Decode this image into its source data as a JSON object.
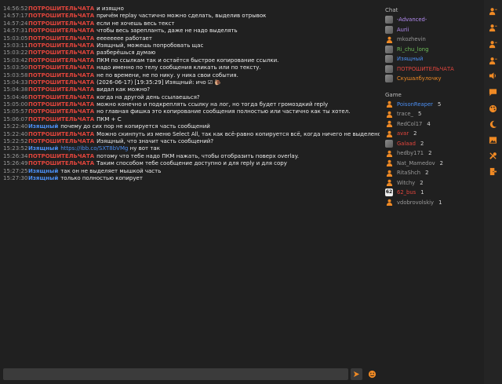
{
  "colors": {
    "accent": "#f08a24",
    "nick_red": "#e2453c",
    "nick_blue": "#4b8ef2",
    "background": "#202020"
  },
  "messages": [
    {
      "time": "14:56:52",
      "nick": "ПОТРОШИТЕЛЬЧАТА",
      "color": "red",
      "text": "и изящно"
    },
    {
      "time": "14:57:17",
      "nick": "ПОТРОШИТЕЛЬЧАТА",
      "color": "red",
      "text": "причём replay частично можно сделать, выделив отрывок"
    },
    {
      "time": "14:57:24",
      "nick": "ПОТРОШИТЕЛЬЧАТА",
      "color": "red",
      "text": "если не хочешь весь текст"
    },
    {
      "time": "14:57:31",
      "nick": "ПОТРОШИТЕЛЬЧАТА",
      "color": "red",
      "text": "чтобы весь зарепланть, даже не надо выделять"
    },
    {
      "time": "15:03:05",
      "nick": "ПОТРОШИТЕЛЬЧАТА",
      "color": "red",
      "text": "ееееееее работает"
    },
    {
      "time": "15:03:11",
      "nick": "ПОТРОШИТЕЛЬЧАТА",
      "color": "red",
      "text": "Изящный, можешь попробовать щас"
    },
    {
      "time": "15:03:22",
      "nick": "ПОТРОШИТЕЛЬЧАТА",
      "color": "red",
      "text": "разберёшься думаю"
    },
    {
      "time": "15:03:42",
      "nick": "ПОТРОШИТЕЛЬЧАТА",
      "color": "red",
      "text": "ПКМ по ссылкам так и остаётся быстрое копирование ссылки."
    },
    {
      "time": "15:03:50",
      "nick": "ПОТРОШИТЕЛЬЧАТА",
      "color": "red",
      "text": "надо именно по телу сообщения кликать или по тексту."
    },
    {
      "time": "15:03:58",
      "nick": "ПОТРОШИТЕЛЬЧАТА",
      "color": "red",
      "text": "не по времени, не по нику. у ника свои события."
    },
    {
      "time": "15:04:33",
      "nick": "ПОТРОШИТЕЛЬЧАТА",
      "color": "red",
      "text": "(2026-06-17) [19:35:29] Изящный: ичо ☑ 🐌"
    },
    {
      "time": "15:04:38",
      "nick": "ПОТРОШИТЕЛЬЧАТА",
      "color": "red",
      "text": "видал как можно?"
    },
    {
      "time": "15:04:46",
      "nick": "ПОТРОШИТЕЛЬЧАТА",
      "color": "red",
      "text": "когда на другой день ссылаешься?"
    },
    {
      "time": "15:05:00",
      "nick": "ПОТРОШИТЕЛЬЧАТА",
      "color": "red",
      "text": "можно конечно и подкреплять ссылку на лог, но тогда будет громоздкий reply"
    },
    {
      "time": "15:05:57",
      "nick": "ПОТРОШИТЕЛЬЧАТА",
      "color": "red",
      "text": "но главная фишка это копирование сообщения полностью или частично как ты хотел."
    },
    {
      "time": "15:06:07",
      "nick": "ПОТРОШИТЕЛЬЧАТА",
      "color": "red",
      "text": "ПКМ + С"
    },
    {
      "time": "15:22:40",
      "nick": "Изящный",
      "color": "blue",
      "text": "почему до сих пор не копируется часть сообщений"
    },
    {
      "time": "15:22:40",
      "nick": "ПОТРОШИТЕЛЬЧАТА",
      "color": "red",
      "text": "Можно скинпуть из меню Select All, так как всё-равно копируется всё, когда ничего не выделено."
    },
    {
      "time": "15:22:52",
      "nick": "ПОТРОШИТЕЛЬЧАТА",
      "color": "red",
      "text": "Изящный, что значит часть сообщений?"
    },
    {
      "time": "15:23:52",
      "nick": "Изящный",
      "color": "blue",
      "text": "https://ibb.co/SXT8bVMg",
      "link": true,
      "suffix": "ну вот так"
    },
    {
      "time": "15:26:34",
      "nick": "ПОТРОШИТЕЛЬЧАТА",
      "color": "red",
      "text": "потому что тебе надо ПКМ нажать, чтобы отобразить поверх overlay."
    },
    {
      "time": "15:26:49",
      "nick": "ПОТРОШИТЕЛЬЧАТА",
      "color": "red",
      "text": "Таким способом тебе сообщение доступно и для reply и для copy"
    },
    {
      "time": "15:27:25",
      "nick": "Изящный",
      "color": "blue",
      "text": "так он не выделяет мышкой часть"
    },
    {
      "time": "15:27:30",
      "nick": "Изящный",
      "color": "blue",
      "text": "только полностью копирует"
    }
  ],
  "sidebar": {
    "chat_title": "Chat",
    "chat_users": [
      {
        "name": "-Advanced-",
        "color": "#b48cf2",
        "avatar": "pic"
      },
      {
        "name": "Aurii",
        "color": "#b48cf2",
        "avatar": "pic"
      },
      {
        "name": "mkozhevin",
        "color": "#9a9a9a",
        "avatar": "person"
      },
      {
        "name": "Ri_chu_long",
        "color": "#6fbf5a",
        "avatar": "pic"
      },
      {
        "name": "Изящный",
        "color": "#4b8ef2",
        "avatar": "pic"
      },
      {
        "name": "ПОТРОШИТЕЛЬЧАТА",
        "color": "#e2453c",
        "avatar": "pic"
      },
      {
        "name": "Скушалбулочку",
        "color": "#f08a24",
        "avatar": "pic"
      }
    ],
    "game_title": "Game",
    "game_users": [
      {
        "name": "PoisonReaper",
        "count": "5",
        "color": "#4b8ef2",
        "avatar": "person"
      },
      {
        "name": "trace_",
        "count": "5",
        "color": "#9a9a9a",
        "avatar": "person"
      },
      {
        "name": "RedCol17",
        "count": "4",
        "color": "#9a9a9a",
        "avatar": "person"
      },
      {
        "name": "avar",
        "count": "2",
        "color": "#e2453c",
        "avatar": "person"
      },
      {
        "name": "Galaad",
        "count": "2",
        "color": "#e2453c",
        "avatar": "pic"
      },
      {
        "name": "hedby171",
        "count": "2",
        "color": "#9a9a9a",
        "avatar": "person"
      },
      {
        "name": "Nat_Mamedov",
        "count": "2",
        "color": "#9a9a9a",
        "avatar": "person"
      },
      {
        "name": "RitaShch",
        "count": "2",
        "color": "#9a9a9a",
        "avatar": "person"
      },
      {
        "name": "Witchy",
        "count": "2",
        "color": "#9a9a9a",
        "avatar": "person"
      },
      {
        "name": "62_bus",
        "count": "1",
        "color": "#e2453c",
        "avatar": "badge",
        "badge": "62"
      },
      {
        "name": "vdobrovolskiy",
        "count": "1",
        "color": "#9a9a9a",
        "avatar": "person"
      }
    ]
  },
  "toolbar": {
    "icons": [
      "user-icon",
      "user-icon",
      "user-icon",
      "user-icon",
      "speaker-icon",
      "chat-icon",
      "palette-icon",
      "moon-icon",
      "image-icon",
      "tools-icon",
      "exit-icon"
    ]
  },
  "input": {
    "value": "",
    "placeholder": ""
  }
}
